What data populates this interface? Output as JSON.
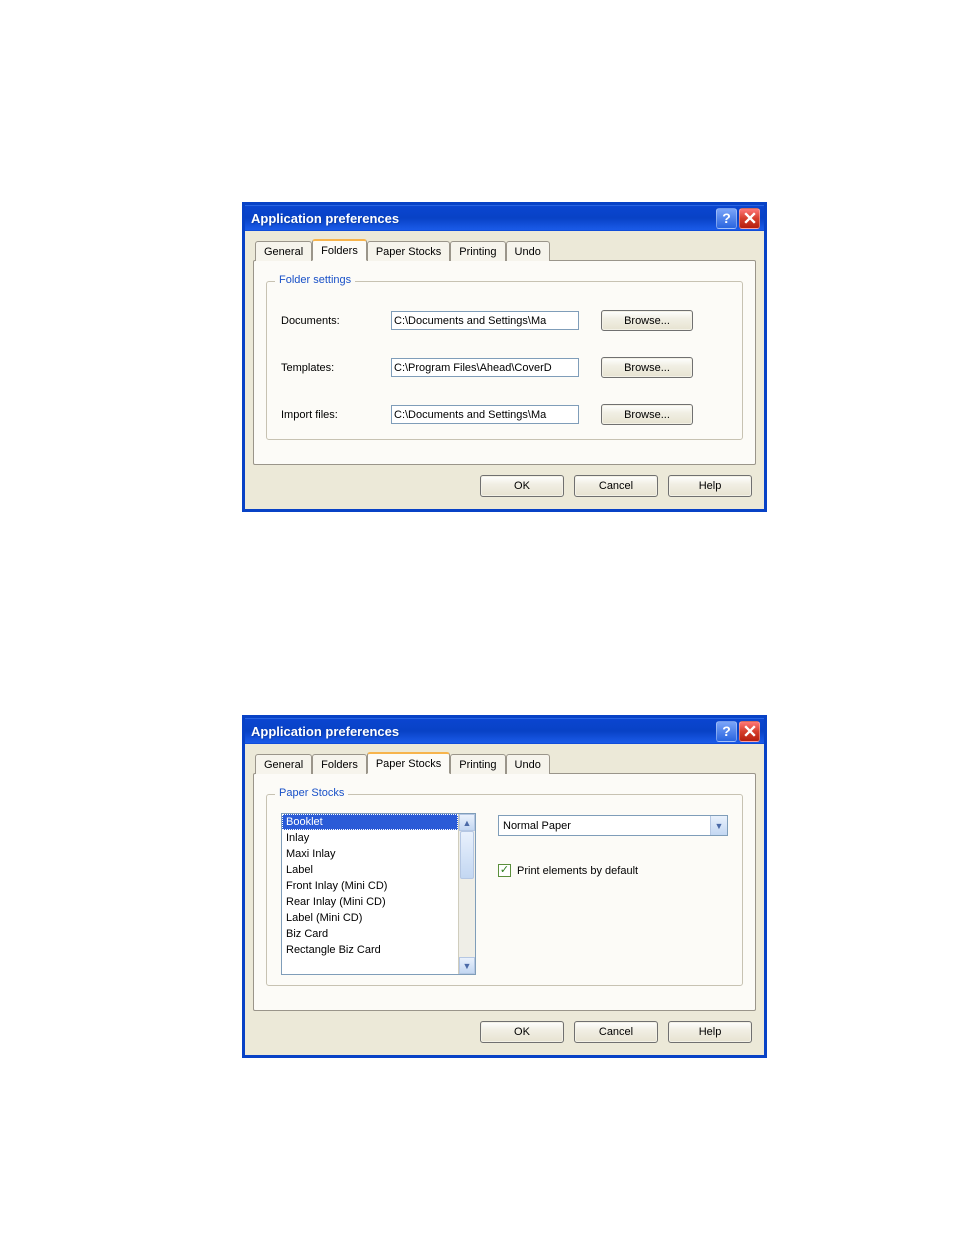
{
  "dialogs": [
    {
      "title": "Application preferences",
      "tabs": [
        "General",
        "Folders",
        "Paper Stocks",
        "Printing",
        "Undo"
      ],
      "active_tab": 1,
      "group_legend": "Folder settings",
      "rows": {
        "documents": {
          "label": "Documents:",
          "value": "C:\\Documents and Settings\\Ma",
          "browse": "Browse..."
        },
        "templates": {
          "label": "Templates:",
          "value": "C:\\Program Files\\Ahead\\CoverD",
          "browse": "Browse..."
        },
        "import": {
          "label": "Import files:",
          "value": "C:\\Documents and Settings\\Ma",
          "browse": "Browse..."
        }
      },
      "buttons": {
        "ok": "OK",
        "cancel": "Cancel",
        "help": "Help"
      }
    },
    {
      "title": "Application preferences",
      "tabs": [
        "General",
        "Folders",
        "Paper Stocks",
        "Printing",
        "Undo"
      ],
      "active_tab": 2,
      "group_legend": "Paper Stocks",
      "list_items": [
        "Booklet",
        "Inlay",
        "Maxi Inlay",
        "Label",
        "Front Inlay (Mini CD)",
        "Rear Inlay (Mini CD)",
        "Label (Mini CD)",
        "Biz Card",
        "Rectangle Biz Card"
      ],
      "selected_index": 0,
      "combo_value": "Normal Paper",
      "checkbox_label": "Print elements by default",
      "checkbox_checked": true,
      "buttons": {
        "ok": "OK",
        "cancel": "Cancel",
        "help": "Help"
      }
    }
  ]
}
